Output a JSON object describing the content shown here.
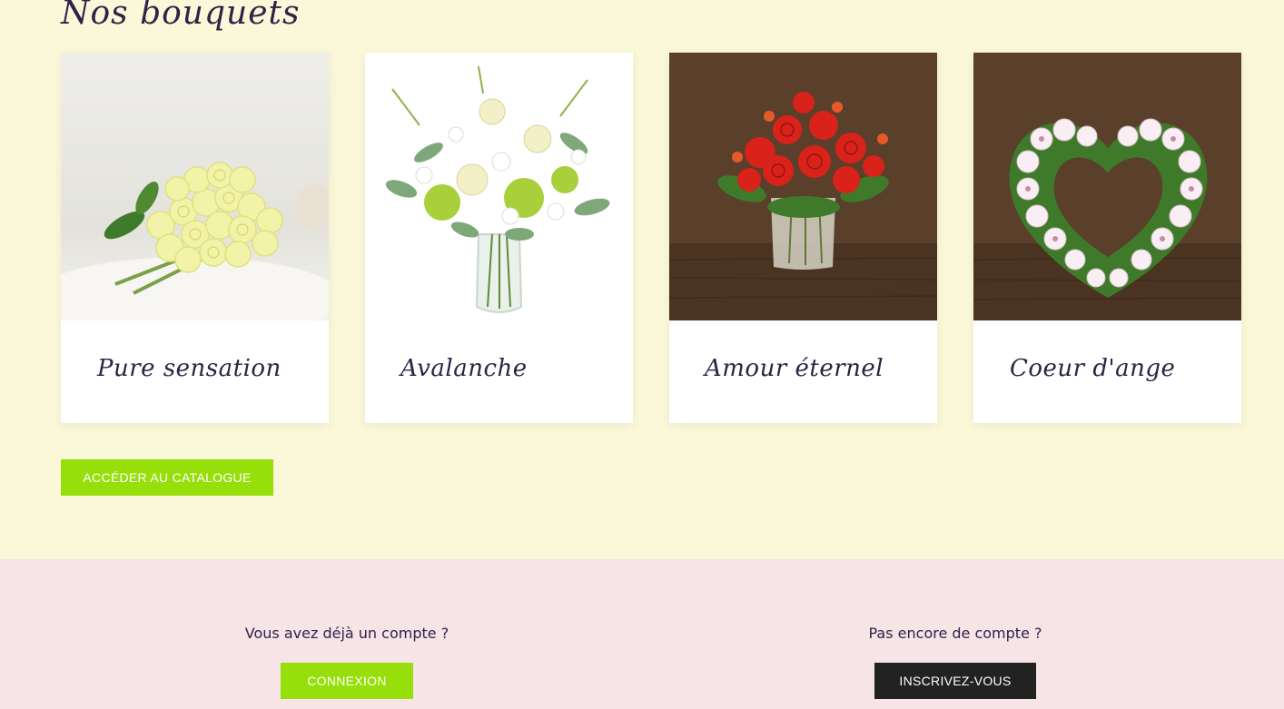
{
  "bouquets": {
    "title": "Nos bouquets",
    "cards": [
      {
        "name": "Pure sensation",
        "image": "white-rose-bouquet-image"
      },
      {
        "name": "Avalanche",
        "image": "green-white-bouquet-vase-image"
      },
      {
        "name": "Amour éternel",
        "image": "red-rose-bouquet-vase-image"
      },
      {
        "name": "Coeur d'ange",
        "image": "white-orchid-heart-wreath-image"
      }
    ],
    "catalogue_button": "ACCÉDER AU CATALOGUE"
  },
  "account": {
    "existing": {
      "text": "Vous avez déjà un compte ?",
      "button": "CONNEXION"
    },
    "new": {
      "text": "Pas encore de compte ?",
      "button": "INSCRIVEZ-VOUS"
    }
  },
  "colors": {
    "page_background": "#fbf8d9",
    "account_background": "#f6e4e6",
    "accent_green": "#96df0a",
    "dark_button": "#222222",
    "text": "#2c2445"
  }
}
